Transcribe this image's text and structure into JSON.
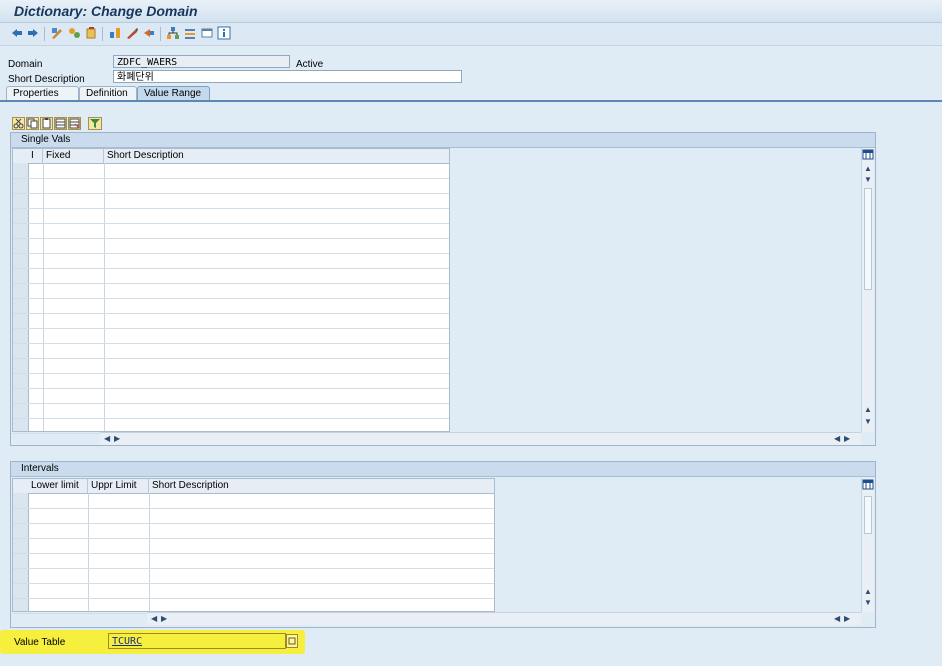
{
  "window": {
    "title": "Dictionary: Change Domain"
  },
  "toolbar": {
    "icons": [
      "back-icon",
      "forward-icon",
      "display-change-icon",
      "other-object-icon",
      "activate-icon",
      "check-icon",
      "where-used-icon",
      "edit-icon",
      "navigate-icon",
      "hierarchy-icon",
      "documentation-icon",
      "display-object-list-icon",
      "info-icon"
    ]
  },
  "header": {
    "domain_label": "Domain",
    "domain_value": "ZDFC_WAERS",
    "status": "Active",
    "short_desc_label": "Short Description",
    "short_desc_value": "화폐단위"
  },
  "tabs": [
    {
      "label": "Properties"
    },
    {
      "label": "Definition"
    },
    {
      "label": "Value Range"
    }
  ],
  "single_vals": {
    "title": "Single Vals",
    "columns": [
      "I",
      "Fixed",
      "Short Description"
    ]
  },
  "intervals": {
    "title": "Intervals",
    "columns": [
      "Lower limit",
      "Uppr Limit",
      "Short Description"
    ]
  },
  "value_table": {
    "label": "Value Table",
    "value": "TCURC"
  },
  "colors": {
    "background": "#dfebf5",
    "highlight": "#f7ef3e",
    "tab_active": "#c5d9ec",
    "title_text": "#17365d"
  }
}
